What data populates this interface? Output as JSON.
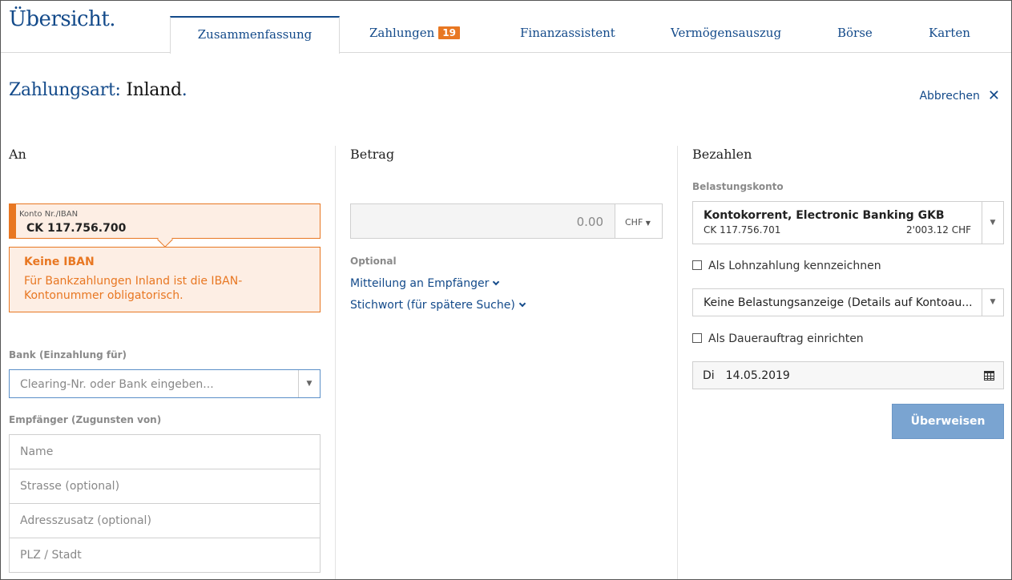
{
  "header": {
    "logo": "Übersicht.",
    "tabs": [
      {
        "label": "Zusammenfassung",
        "active": true
      },
      {
        "label": "Zahlungen",
        "badge": "19"
      },
      {
        "label": "Finanzassistent"
      },
      {
        "label": "Vermögensauszug"
      },
      {
        "label": "Börse"
      },
      {
        "label": "Karten"
      }
    ]
  },
  "page": {
    "title_prefix": "Zahlungsart:",
    "title_value": "Inland",
    "title_dot": ".",
    "cancel_label": "Abbrechen",
    "cancel_icon": "close-icon"
  },
  "to": {
    "heading": "An",
    "konto_label": "Konto Nr./IBAN",
    "konto_value": "CK 117.756.700",
    "error_title": "Keine IBAN",
    "error_text": "Für Bankzahlungen Inland ist die IBAN-Kontonummer obligatorisch.",
    "bank_label": "Bank (Einzahlung für)",
    "bank_placeholder": "Clearing-Nr. oder Bank eingeben...",
    "recipient_label": "Empfänger (Zugunsten von)",
    "recipient_fields": [
      "Name",
      "Strasse (optional)",
      "Adresszusatz (optional)",
      "PLZ / Stadt"
    ]
  },
  "amount": {
    "heading": "Betrag",
    "value": "0.00",
    "currency": "CHF",
    "optional_label": "Optional",
    "message_link": "Mitteilung an Empfänger",
    "keyword_link": "Stichwort (für spätere Suche)"
  },
  "pay": {
    "heading": "Bezahlen",
    "debit_label": "Belastungskonto",
    "account_name": "Kontokorrent, Electronic Banking GKB",
    "account_iban": "CK 117.756.701",
    "account_balance": "2'003.12 CHF",
    "salary_label": "Als Lohnzahlung kennzeichnen",
    "notification_value": "Keine Belastungsanzeige (Details auf Kontoau...",
    "standing_order_label": "Als Dauerauftrag einrichten",
    "date_day": "Di",
    "date_value": "14.05.2019",
    "submit_label": "Überweisen"
  },
  "colors": {
    "brand": "#134a8a",
    "accent": "#e87722",
    "button": "#7aa4d1"
  }
}
